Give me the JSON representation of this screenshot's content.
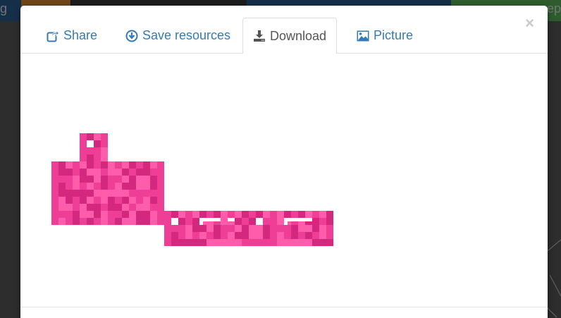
{
  "background": {
    "left_label": "g",
    "right_label": "epp",
    "colors": {
      "toolbar": "#2c5f93",
      "orange": "#e08a2f",
      "green": "#5cb85c"
    }
  },
  "modal": {
    "tabs": [
      {
        "label": "Share",
        "icon": "share-square-icon",
        "active": false
      },
      {
        "label": "Save resources",
        "icon": "download-circle-icon",
        "active": false
      },
      {
        "label": "Download",
        "icon": "download-tray-icon",
        "active": true
      },
      {
        "label": "Picture",
        "icon": "picture-icon",
        "active": false
      }
    ],
    "close_label": "×",
    "preview": {
      "description": "pixel-art sprite sheet preview",
      "colors": {
        "primary": "#ee3e96",
        "dark": "#d4287e",
        "light": "#ff5cab",
        "highlight": "#ffffff"
      }
    },
    "colors": {
      "link": "#337ab7",
      "active_tab_text": "#555555",
      "border": "#dddddd"
    }
  }
}
